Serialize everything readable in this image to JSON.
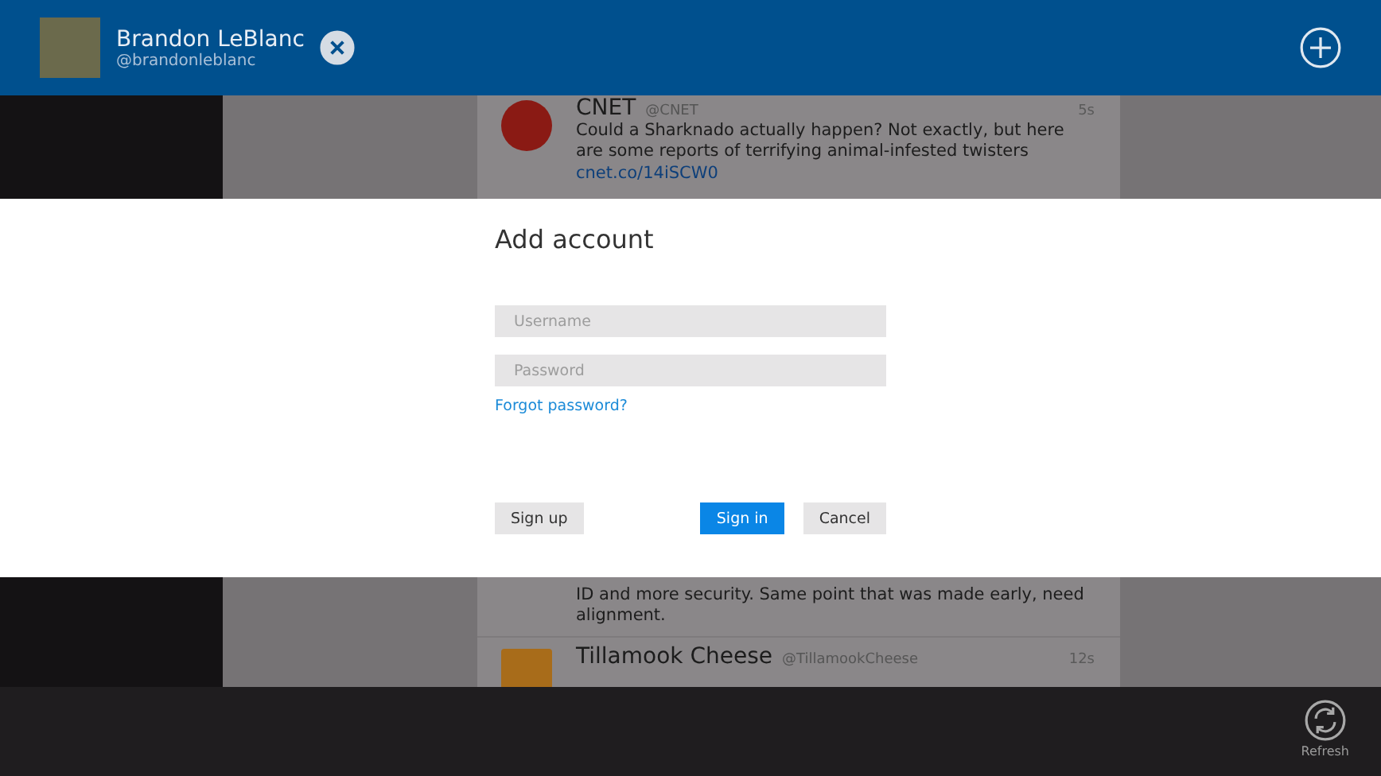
{
  "header": {
    "name": "Brandon LeBlanc",
    "handle": "@brandonleblanc"
  },
  "feed": [
    {
      "kind": "full",
      "author": "CNET",
      "handle": "@CNET",
      "time": "5s",
      "text": "Could a Sharknado actually happen? Not exactly, but here are some reports of terrifying animal-infested twisters",
      "link": "cnet.co/14iSCW0"
    },
    {
      "kind": "body",
      "text": "ID and more security. Same point that was made early, need alignment."
    },
    {
      "kind": "header",
      "author": "Tillamook Cheese",
      "handle": "@TillamookCheese",
      "time": "12s"
    }
  ],
  "dialog": {
    "title": "Add account",
    "username": {
      "placeholder": "Username"
    },
    "password": {
      "placeholder": "Password"
    },
    "forgot": "Forgot password?",
    "buttons": [
      {
        "label": "Sign up",
        "primary": false
      },
      {
        "label": "Sign in",
        "primary": true
      },
      {
        "label": "Cancel",
        "primary": false
      }
    ]
  },
  "app_bar": [
    {
      "label": "Refresh"
    }
  ]
}
